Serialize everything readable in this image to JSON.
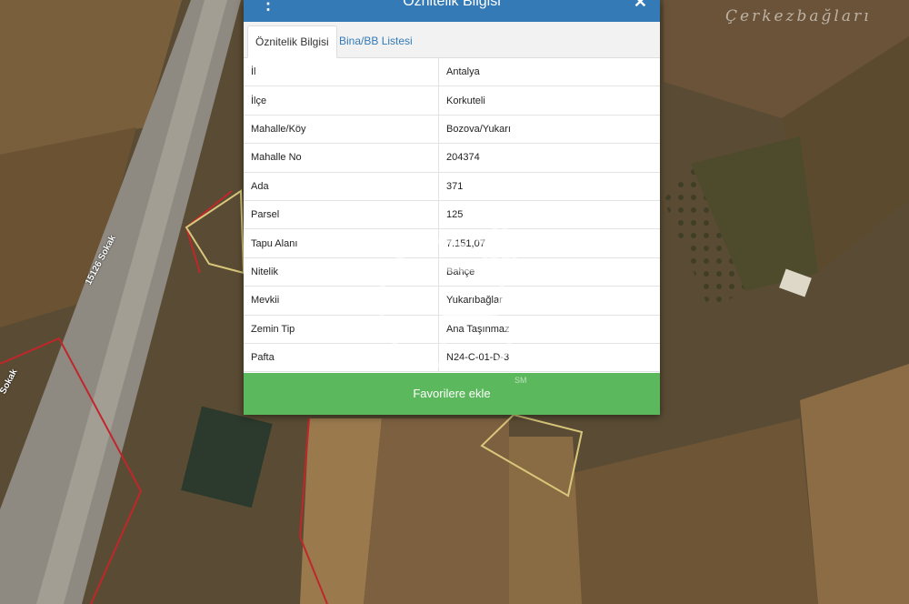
{
  "map": {
    "place_label": "Çerkezbağları",
    "road_label_1": "15126 Sokak",
    "road_label_2": "Sokak"
  },
  "panel": {
    "title": "Öznitelik Bilgisi",
    "tabs": [
      "Öznitelik Bilgisi",
      "Bina/BB Listesi"
    ],
    "rows": [
      {
        "key": "İl",
        "value": "Antalya"
      },
      {
        "key": "İlçe",
        "value": "Korkuteli"
      },
      {
        "key": "Mahalle/Köy",
        "value": "Bozova/Yukarı"
      },
      {
        "key": "Mahalle No",
        "value": "204374"
      },
      {
        "key": "Ada",
        "value": "371"
      },
      {
        "key": "Parsel",
        "value": "125"
      },
      {
        "key": "Tapu Alanı",
        "value": "7.151,07"
      },
      {
        "key": "Nitelik",
        "value": "Bahçe"
      },
      {
        "key": "Mevkii",
        "value": "Yukarıbağlar"
      },
      {
        "key": "Zemin Tip",
        "value": "Ana Taşınmaz"
      },
      {
        "key": "Pafta",
        "value": "N24-C-01-D-3"
      }
    ],
    "favorite_button": "Favorilere ekle"
  },
  "watermark": {
    "badge": "SM"
  },
  "colors": {
    "header": "#337ab7",
    "button": "#5cb85c",
    "parcel_red": "#c0262a",
    "parcel_yellow": "#d8c77a"
  }
}
